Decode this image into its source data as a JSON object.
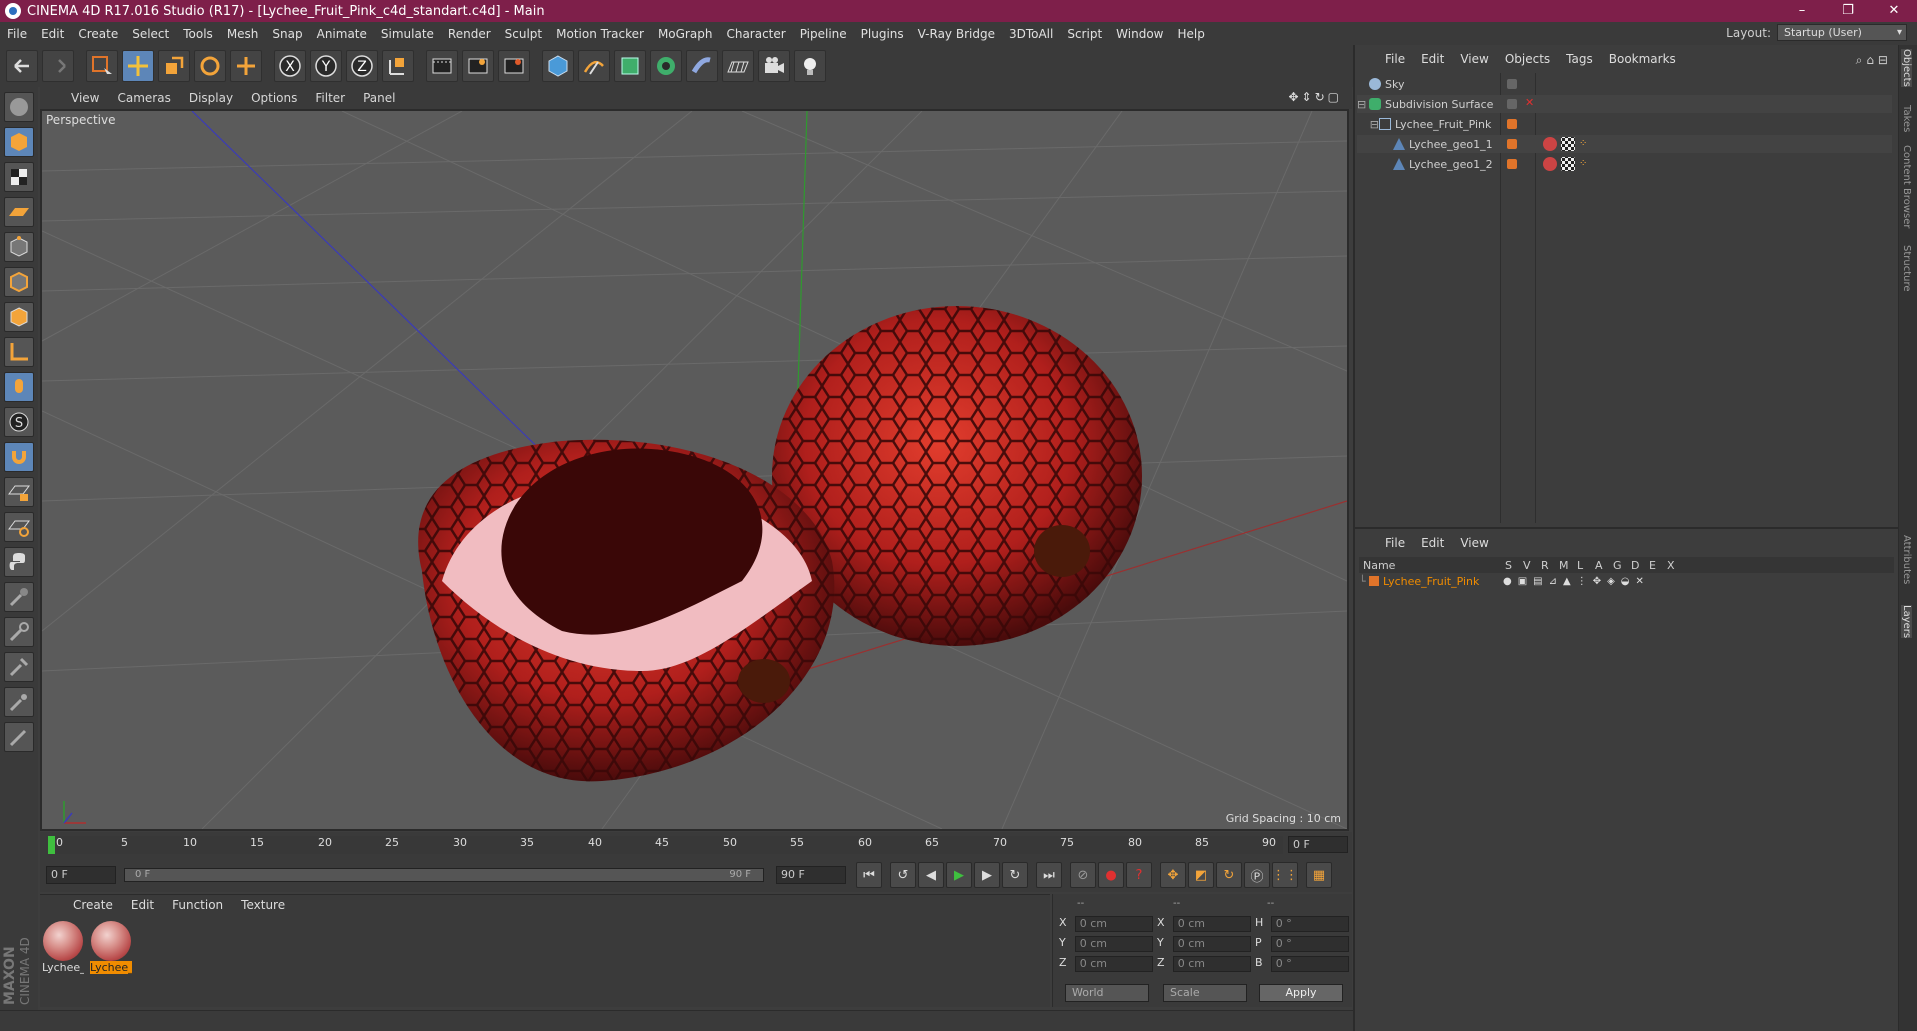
{
  "window": {
    "title": "CINEMA 4D R17.016 Studio (R17) - [Lychee_Fruit_Pink_c4d_standart.c4d] - Main",
    "controls": [
      "–",
      "❐",
      "✕"
    ]
  },
  "menubar": {
    "items": [
      "File",
      "Edit",
      "Create",
      "Select",
      "Tools",
      "Mesh",
      "Snap",
      "Animate",
      "Simulate",
      "Render",
      "Sculpt",
      "Motion Tracker",
      "MoGraph",
      "Character",
      "Pipeline",
      "Plugins",
      "V-Ray Bridge",
      "3DToAll",
      "Script",
      "Window",
      "Help"
    ],
    "layout_label": "Layout:",
    "layout_value": "Startup (User)"
  },
  "toolbar": {
    "icons": [
      "undo-icon",
      "redo-icon",
      "live-select-icon",
      "move-icon",
      "scale-icon",
      "rotate-icon",
      "last-tool-icon",
      "x-axis-icon",
      "y-axis-icon",
      "z-axis-icon",
      "world-coord-icon",
      "render-view-icon",
      "render-picture-viewer-icon",
      "edit-render-settings-icon",
      "cube-icon",
      "pen-spline-icon",
      "subdivision-icon",
      "array-icon",
      "deformer-icon",
      "floor-icon",
      "camera-icon",
      "light-icon"
    ],
    "axis_letters": [
      "X",
      "Y",
      "Z"
    ]
  },
  "left_tools": {
    "icons": [
      "make-editable-icon",
      "model-mode-icon",
      "texture-mode-icon",
      "workplane-icon",
      "points-mode-icon",
      "edges-mode-icon",
      "polygons-mode-icon",
      "axis-mode-icon",
      "tweak-mode-icon",
      "solo-icon",
      "snap-magnet-icon",
      "workplane-lock-icon",
      "animation-icon",
      "python-icon",
      "brush-icon",
      "paint-icon",
      "sculpt-icon",
      "sculpt-smooth-icon",
      "sculpt-knife-icon"
    ]
  },
  "viewport": {
    "menu": [
      "View",
      "Cameras",
      "Display",
      "Options",
      "Filter",
      "Panel"
    ],
    "label": "Perspective",
    "grid_spacing": "Grid Spacing : 10 cm"
  },
  "timeline": {
    "ticks": [
      "0",
      "5",
      "10",
      "15",
      "20",
      "25",
      "30",
      "35",
      "40",
      "45",
      "50",
      "55",
      "60",
      "65",
      "70",
      "75",
      "80",
      "85",
      "90"
    ],
    "current_frame": "0 F",
    "start_field": "0 F",
    "slider_start": "0 F",
    "slider_end": "90 F",
    "end_field": "90 F"
  },
  "material_manager": {
    "menu": [
      "Create",
      "Edit",
      "Function",
      "Texture"
    ],
    "materials": [
      {
        "name": "Lychee_",
        "selected": false
      },
      {
        "name": "Lychee_",
        "selected": true
      }
    ]
  },
  "coordinates": {
    "header": [
      "--",
      "--",
      "--"
    ],
    "rows": [
      {
        "a": "X",
        "av": "0 cm",
        "b": "X",
        "bv": "0 cm",
        "c": "H",
        "cv": "0 °"
      },
      {
        "a": "Y",
        "av": "0 cm",
        "b": "Y",
        "bv": "0 cm",
        "c": "P",
        "cv": "0 °"
      },
      {
        "a": "Z",
        "av": "0 cm",
        "b": "Z",
        "bv": "0 cm",
        "c": "B",
        "cv": "0 °"
      }
    ],
    "mode": "World",
    "scale": "Scale",
    "apply": "Apply"
  },
  "branding": {
    "line1": "MAXON",
    "line2": "CINEMA 4D"
  },
  "object_manager": {
    "menu": [
      "File",
      "Edit",
      "View",
      "Objects",
      "Tags",
      "Bookmarks"
    ],
    "objects": [
      {
        "name": "Sky",
        "indent": 0
      },
      {
        "name": "Subdivision Surface",
        "indent": 0
      },
      {
        "name": "Lychee_Fruit_Pink",
        "indent": 1
      },
      {
        "name": "Lychee_geo1_1",
        "indent": 2
      },
      {
        "name": "Lychee_geo1_2",
        "indent": 2
      }
    ]
  },
  "layer_manager": {
    "menu": [
      "File",
      "Edit",
      "View"
    ],
    "columns": [
      "Name",
      "S",
      "V",
      "R",
      "M",
      "L",
      "A",
      "G",
      "D",
      "E",
      "X"
    ],
    "layers": [
      {
        "name": "Lychee_Fruit_Pink",
        "color": "#f08c00"
      }
    ]
  },
  "right_tabs": [
    "Objects",
    "Takes",
    "Content Browser",
    "Structure",
    "Attributes",
    "Layers"
  ],
  "colors": {
    "title_bg": "#7e1f4a",
    "accent": "#f08c00"
  }
}
